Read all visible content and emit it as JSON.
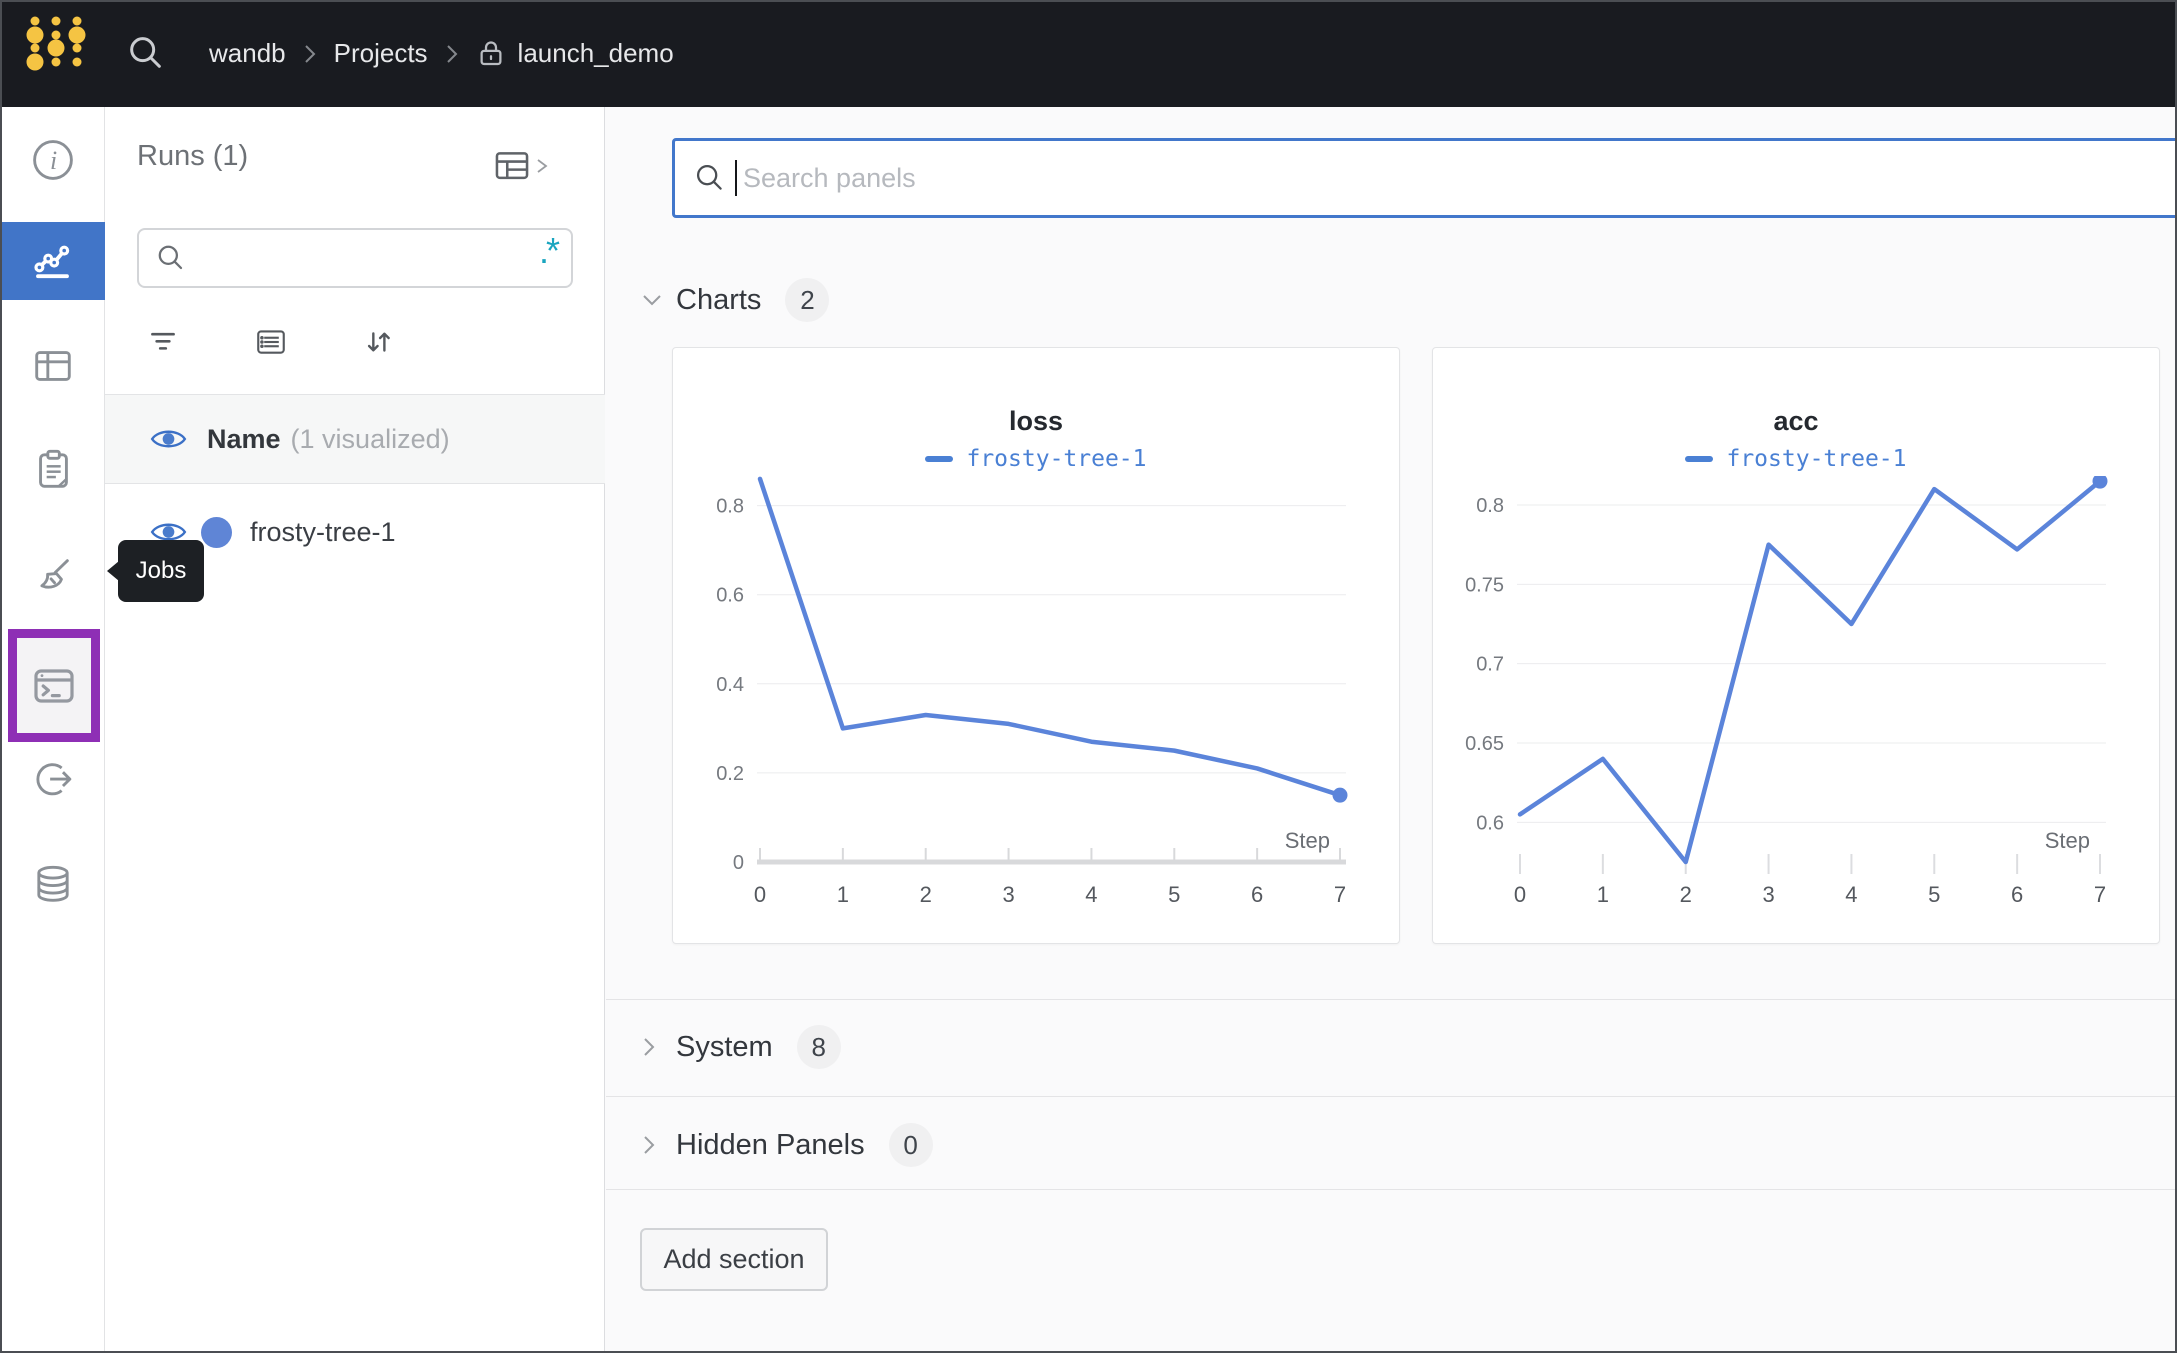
{
  "header": {
    "breadcrumb": {
      "team": "wandb",
      "section": "Projects",
      "project": "launch_demo"
    }
  },
  "sidebar": {
    "tooltip": "Jobs",
    "items": [
      "overview",
      "workspace",
      "runs-table",
      "reports",
      "sweeps",
      "jobs",
      "automations",
      "artifacts"
    ]
  },
  "runs_panel": {
    "title": "Runs (1)",
    "search_value": "",
    "regex_icon": ".*",
    "name_header": "Name",
    "visualized_note": "(1 visualized)",
    "runs": [
      {
        "name": "frosty-tree-1",
        "color": "#5f85d6"
      }
    ]
  },
  "main": {
    "search_placeholder": "Search panels",
    "sections": [
      {
        "label": "Charts",
        "count": "2",
        "expanded": true
      },
      {
        "label": "System",
        "count": "8",
        "expanded": false
      },
      {
        "label": "Hidden Panels",
        "count": "0",
        "expanded": false
      }
    ],
    "add_section_label": "Add section"
  },
  "chart_data": [
    {
      "type": "line",
      "title": "loss",
      "xlabel": "Step",
      "x": [
        0,
        1,
        2,
        3,
        4,
        5,
        6,
        7
      ],
      "series": [
        {
          "name": "frosty-tree-1",
          "values": [
            0.86,
            0.3,
            0.33,
            0.31,
            0.27,
            0.25,
            0.21,
            0.15
          ]
        }
      ],
      "yticks": [
        0,
        0.2,
        0.4,
        0.6,
        0.8
      ],
      "ylim": [
        0,
        0.862
      ],
      "baseline": true,
      "end_dot": true,
      "grid": true,
      "legend_position": "top"
    },
    {
      "type": "line",
      "title": "acc",
      "xlabel": "Step",
      "x": [
        0,
        1,
        2,
        3,
        4,
        5,
        6,
        7
      ],
      "series": [
        {
          "name": "frosty-tree-1",
          "values": [
            0.605,
            0.64,
            0.575,
            0.775,
            0.725,
            0.81,
            0.772,
            0.815
          ]
        }
      ],
      "yticks": [
        0.6,
        0.65,
        0.7,
        0.75,
        0.8
      ],
      "ylim": [
        0.575,
        0.817
      ],
      "baseline": false,
      "end_dot": true,
      "grid": true,
      "legend_position": "top"
    }
  ],
  "colors": {
    "accent_blue": "#4175c8",
    "line_blue": "#5b84da",
    "legend_blue": "#4a80d4",
    "run_dot": "#5f85d6",
    "highlight_purple": "#8e2fb5",
    "regex_teal": "#1aa5bf",
    "header_bg": "#191b20",
    "logo_gold": "#f5c443"
  }
}
